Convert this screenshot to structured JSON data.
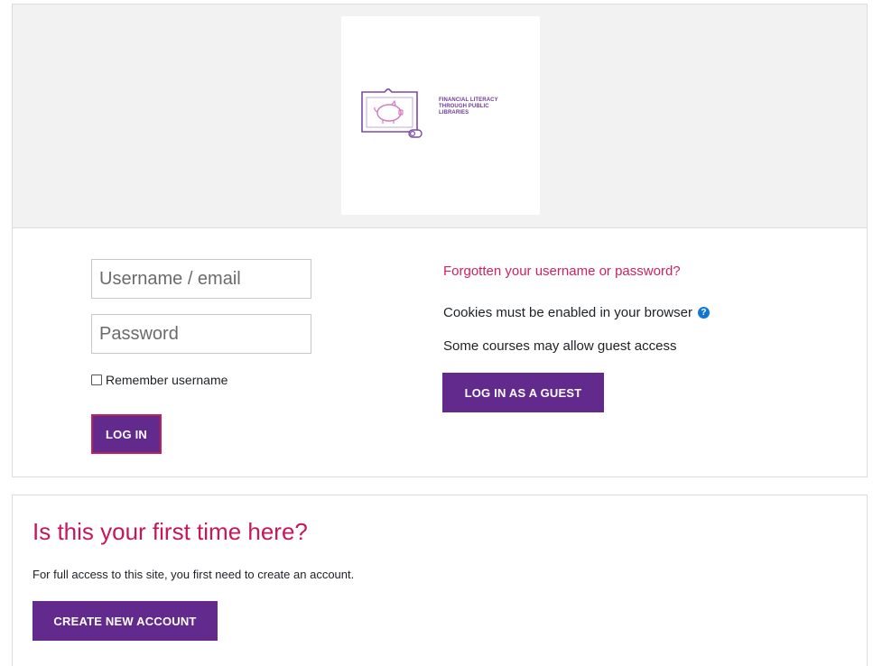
{
  "logo": {
    "line1": "FINANCIAL LITERACY",
    "line2": "THROUGH PUBLIC",
    "line3": "LIBRARIES"
  },
  "login_form": {
    "username_placeholder": "Username / email",
    "password_placeholder": "Password",
    "remember_label": "Remember username",
    "login_button": "LOG IN"
  },
  "side_info": {
    "forgot_link": "Forgotten your username or password?",
    "cookies_text": "Cookies must be enabled in your browser",
    "help_icon_glyph": "?",
    "guest_note": "Some courses may allow guest access",
    "guest_button": "LOG IN AS A GUEST"
  },
  "signup": {
    "title": "Is this your first time here?",
    "text": "For full access to this site, you first need to create an account.",
    "create_button": "CREATE NEW ACCOUNT"
  },
  "colors": {
    "primary_button": "#622a8c",
    "accent_link": "#d11f5f",
    "heading": "#c4175c",
    "help_icon": "#1177d1"
  },
  "icons": {
    "logo": "piggy-bank-book-icon",
    "help": "question-circle-icon"
  }
}
